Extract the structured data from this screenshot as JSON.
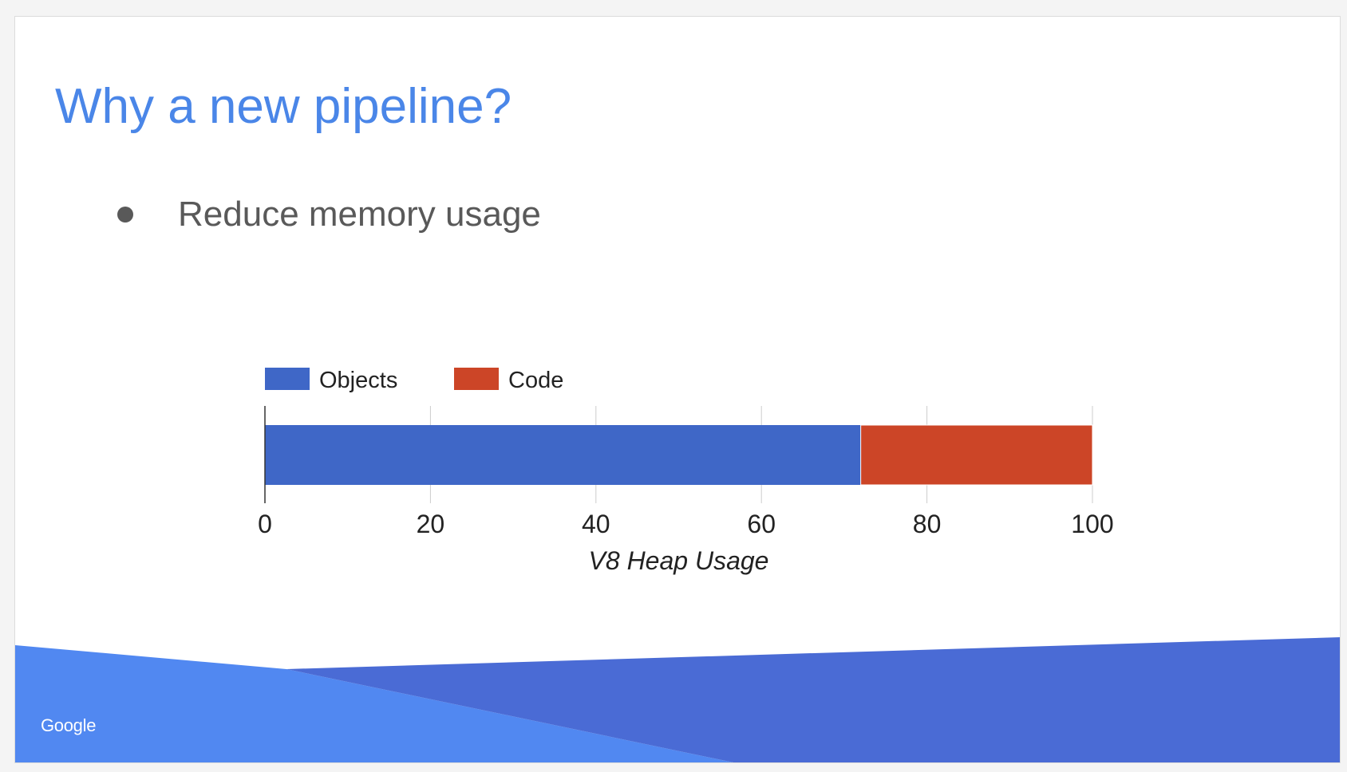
{
  "slide": {
    "title": "Why a new pipeline?",
    "bullets": [
      "Reduce memory usage"
    ],
    "logo_text": "Google"
  },
  "colors": {
    "title": "#4a86e8",
    "body_text": "#595959",
    "footer_light": "#5188f1",
    "footer_dark": "#4a6bd5"
  },
  "chart_data": {
    "type": "bar",
    "orientation": "horizontal",
    "stacked": true,
    "categories": [
      ""
    ],
    "series": [
      {
        "name": "Objects",
        "values": [
          72
        ],
        "color": "#3f67c7"
      },
      {
        "name": "Code",
        "values": [
          28
        ],
        "color": "#cc4527"
      }
    ],
    "xlabel": "V8 Heap Usage",
    "ylabel": "",
    "xlim": [
      0,
      100
    ],
    "x_ticks": [
      0,
      20,
      40,
      60,
      80,
      100
    ],
    "grid": true,
    "legend_position": "top-left"
  }
}
